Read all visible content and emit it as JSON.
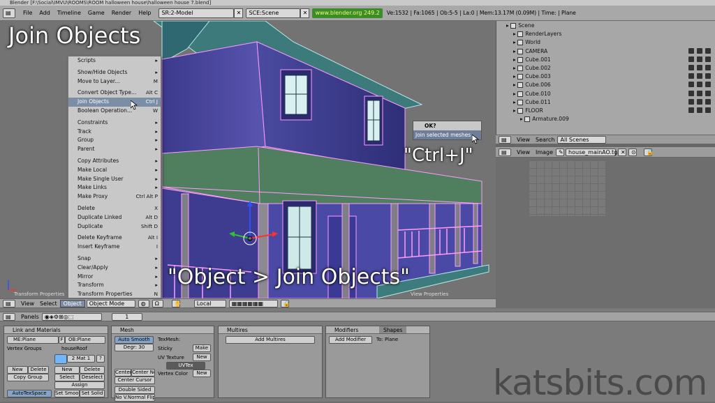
{
  "window_title": "Blender [F:\\Social\\IMVU\\ROOMS\\ROOM halloween house\\halloween house 7.blend]",
  "topbar": {
    "menus": [
      "File",
      "Add",
      "Timeline",
      "Game",
      "Render",
      "Help"
    ],
    "screen": "SR:2-Model",
    "scene": "SCE:Scene",
    "url": "www.blender.org 249.2",
    "stats": "Ve:1532 | Fa:1065 | Ob:5-5 | La:0  | Mem:13.17M (0.09M)  | Time: | Plane"
  },
  "overlays": {
    "heading": "Join Objects",
    "shortcut": "\"Ctrl+J\"",
    "path": "\"Object > Join Objects\""
  },
  "menu": [
    {
      "label": "Scripts",
      "sc": "▸"
    },
    {
      "sep": true
    },
    {
      "label": "Show/Hide Objects",
      "sc": "▸"
    },
    {
      "label": "Move to Layer...",
      "sc": "M"
    },
    {
      "sep": true
    },
    {
      "label": "Convert Object Type...",
      "sc": "Alt C"
    },
    {
      "label": "Join Objects",
      "sc": "Ctrl J",
      "hl": true
    },
    {
      "label": "Boolean Operation...",
      "sc": "W"
    },
    {
      "sep": true
    },
    {
      "label": "Constraints",
      "sc": "▸"
    },
    {
      "label": "Track",
      "sc": "▸"
    },
    {
      "label": "Group",
      "sc": "▸"
    },
    {
      "label": "Parent",
      "sc": "▸"
    },
    {
      "sep": true
    },
    {
      "label": "Copy Attributes",
      "sc": "▸"
    },
    {
      "label": "Make Local",
      "sc": "▸"
    },
    {
      "label": "Make Single User",
      "sc": "▸"
    },
    {
      "label": "Make Links",
      "sc": "▸"
    },
    {
      "label": "Make Proxy",
      "sc": "Ctrl Alt P"
    },
    {
      "sep": true
    },
    {
      "label": "Delete",
      "sc": "X"
    },
    {
      "label": "Duplicate Linked",
      "sc": "Alt D"
    },
    {
      "label": "Duplicate",
      "sc": "Shift D"
    },
    {
      "sep": true
    },
    {
      "label": "Delete Keyframe",
      "sc": "Alt I"
    },
    {
      "label": "Insert Keyframe",
      "sc": "I"
    },
    {
      "sep": true
    },
    {
      "label": "Snap",
      "sc": "▸"
    },
    {
      "label": "Clear/Apply",
      "sc": "▸"
    },
    {
      "label": "Mirror",
      "sc": "▸"
    },
    {
      "label": "Transform",
      "sc": "▸"
    },
    {
      "label": "Transform Properties",
      "sc": "N"
    }
  ],
  "confirm": {
    "title": "OK?",
    "option": "Join selected meshes"
  },
  "outliner": {
    "rows": [
      {
        "label": "Scene",
        "indent": 0,
        "vis": false
      },
      {
        "label": "RenderLayers",
        "indent": 1,
        "vis": false
      },
      {
        "label": "World",
        "indent": 1,
        "vis": false
      },
      {
        "label": "CAMERA",
        "indent": 1,
        "vis": true
      },
      {
        "label": "Cube.001",
        "indent": 1,
        "vis": true
      },
      {
        "label": "Cube.002",
        "indent": 1,
        "vis": true
      },
      {
        "label": "Cube.003",
        "indent": 1,
        "vis": true
      },
      {
        "label": "Cube.006",
        "indent": 1,
        "vis": true
      },
      {
        "label": "Cube.010",
        "indent": 1,
        "vis": true
      },
      {
        "label": "Cube.011",
        "indent": 1,
        "vis": true
      },
      {
        "label": "FLOOR",
        "indent": 1,
        "vis": true
      },
      {
        "label": "Armature.009",
        "indent": 2,
        "vis": false
      }
    ],
    "header": {
      "view": "View",
      "search": "Search",
      "filter": "All Scenes"
    }
  },
  "image_header": {
    "view": "View",
    "image": "Image",
    "file": "house_mainAO.tga"
  },
  "viewport_header": {
    "view": "View",
    "select": "Select",
    "object": "Object",
    "mode": "Object Mode",
    "pivot": "Local",
    "left_label": "Transform Properties",
    "right_label": "View Properties"
  },
  "buttons_header": {
    "panels": "Panels",
    "frame": "1"
  },
  "link_panel": {
    "title": "Link and Materials",
    "me": "ME:Plane",
    "f": "F",
    "ob": "OB:Plane",
    "vertex_groups": "Vertex Groups",
    "mat_name": "houseRoof",
    "mat": "2 Mat 1",
    "q": "?",
    "new": "New",
    "delete": "Delete",
    "copy_group": "Copy Group",
    "select": "Select",
    "deselect": "Deselect",
    "assign": "Assign",
    "autotex": "AutoTexSpace",
    "set_smooth": "Set Smoot",
    "set_solid": "Set Solid"
  },
  "mesh_panel": {
    "title": "Mesh",
    "auto_smooth": "Auto Smooth",
    "degr": "Degr: 30",
    "texmesh": "TexMesh:",
    "sticky": "Sticky",
    "make": "Make",
    "uv_texture": "UV Texture",
    "new": "New",
    "uvtex": "UVTex",
    "vertex_color": "Vertex Color",
    "center": "Center",
    "center_new": "Center New",
    "center_cursor": "Center Cursor",
    "double_sided": "Double Sided",
    "no_vnormal": "No V.Normal Flip"
  },
  "multires_panel": {
    "title": "Multires",
    "add": "Add Multires"
  },
  "modifiers_panel": {
    "tab1": "Modifiers",
    "tab2": "Shapes",
    "add": "Add Modifier",
    "to": "To: Plane"
  },
  "watermark": "katsbits.com"
}
